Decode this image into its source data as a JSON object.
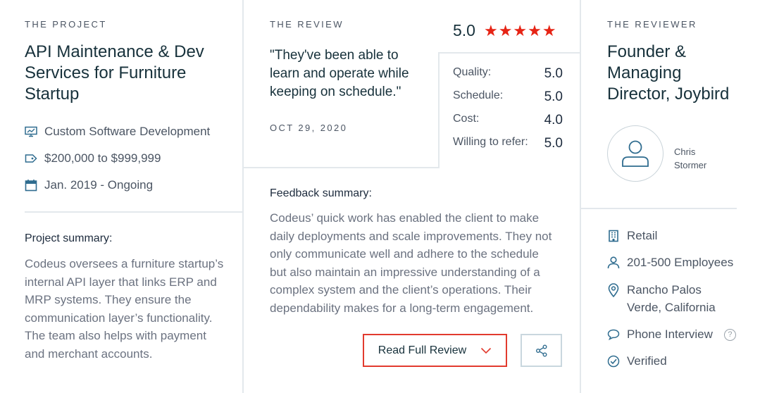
{
  "project": {
    "eyebrow": "THE PROJECT",
    "title": "API Maintenance & Dev Services for Furniture Startup",
    "service": "Custom Software Development",
    "budget": "$200,000 to $999,999",
    "dates": "Jan. 2019 - Ongoing",
    "summary_heading": "Project summary:",
    "summary": "Codeus oversees a furniture startup’s internal API layer that links ERP and MRP systems. They ensure the communication layer’s functionality. The team also helps with payment and merchant accounts."
  },
  "review": {
    "eyebrow": "THE REVIEW",
    "quote": "\"They've been able to learn and operate while keeping on schedule.\"",
    "date": "OCT 29, 2020",
    "overall": "5.0",
    "stars_count": 5,
    "stars": "★★★★★",
    "scores": [
      {
        "label": "Quality:",
        "value": "5.0"
      },
      {
        "label": "Schedule:",
        "value": "5.0"
      },
      {
        "label": "Cost:",
        "value": "4.0"
      },
      {
        "label": "Willing to refer:",
        "value": "5.0"
      }
    ],
    "feedback_heading": "Feedback summary:",
    "feedback": "Codeus’ quick work has enabled the client to make daily deployments and scale improvements. They not only communicate well and adhere to the schedule but also maintain an impressive understanding of a complex system and the client’s operations. Their dependability makes for a long-term engagement.",
    "read_button_label": "Read Full Review"
  },
  "reviewer": {
    "eyebrow": "THE REVIEWER",
    "title": "Founder & Managing Director, Joybird",
    "name": "Chris Stormer",
    "industry": "Retail",
    "employees": "201-500 Employees",
    "location": "Rancho Palos Verde, California",
    "interview_type": "Phone Interview",
    "help_glyph": "?",
    "verified": "Verified"
  },
  "colors": {
    "accent_red": "#e62415",
    "divider": "#e3e8ec",
    "icon_blue": "#2f6c8f"
  },
  "icons": [
    "presentation-icon",
    "price-tag-icon",
    "calendar-icon",
    "user-avatar-icon",
    "building-icon",
    "person-icon",
    "location-pin-icon",
    "chat-bubble-icon",
    "help-icon",
    "check-circle-icon",
    "chevron-down-icon",
    "share-icon"
  ]
}
